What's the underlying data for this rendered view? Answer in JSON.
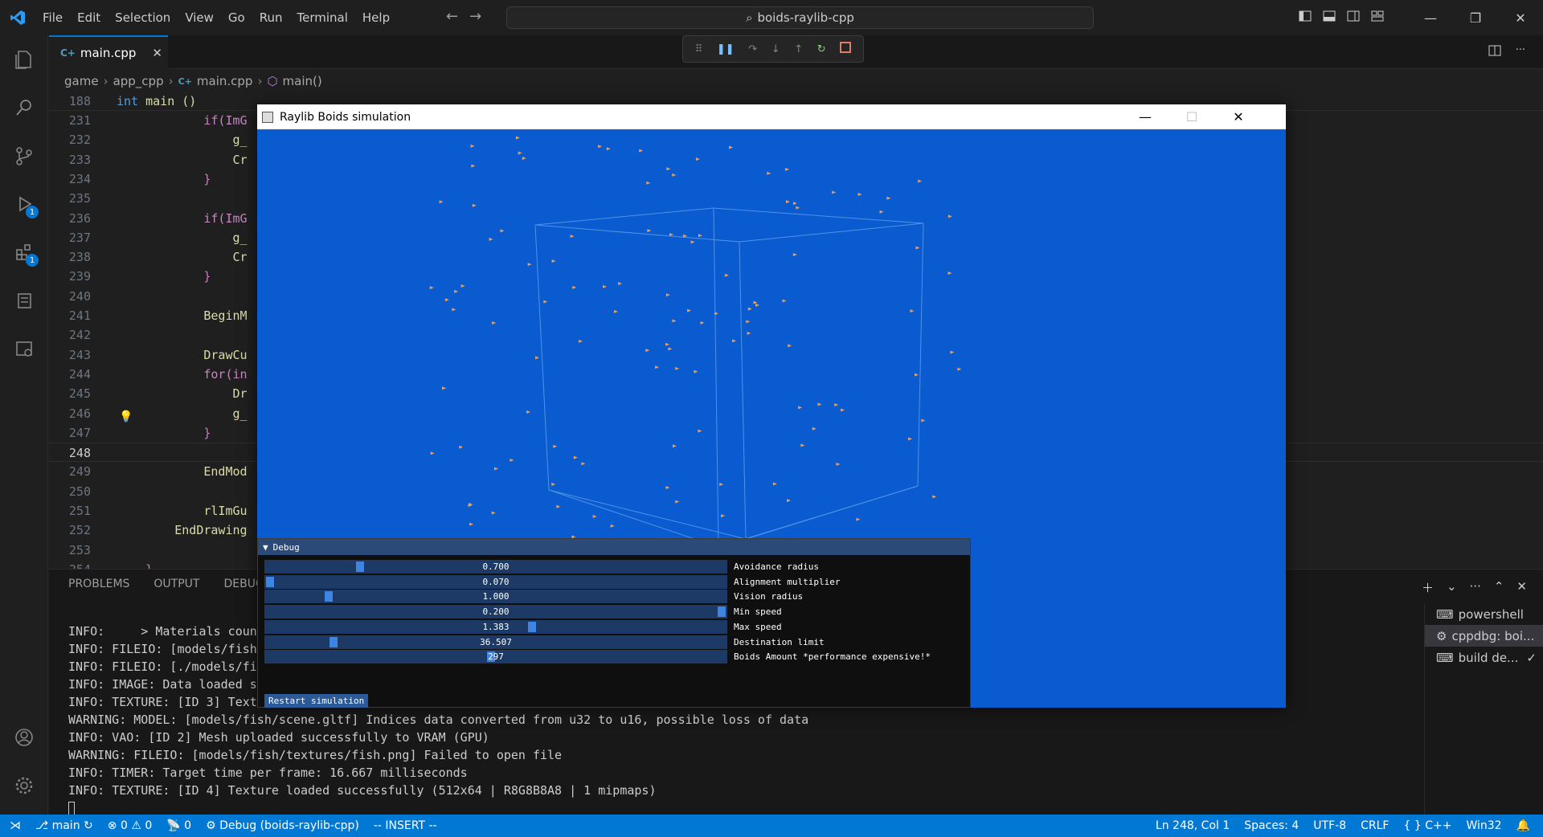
{
  "titlebar": {
    "menu": [
      "File",
      "Edit",
      "Selection",
      "View",
      "Go",
      "Run",
      "Terminal",
      "Help"
    ],
    "search": "boids-raylib-cpp"
  },
  "activity": {
    "debug_badge": "1",
    "extensions_badge": "1"
  },
  "tab": {
    "label": "main.cpp"
  },
  "breadcrumb": [
    "game",
    "app_cpp",
    "main.cpp",
    "main()"
  ],
  "editor": {
    "sticky_line": {
      "num": "188",
      "kw": "int",
      "rest": " main ()"
    },
    "lines": [
      {
        "num": "231",
        "text": "            if(ImG"
      },
      {
        "num": "232",
        "text": "                g_"
      },
      {
        "num": "233",
        "text": "                Cr"
      },
      {
        "num": "234",
        "text": "            }"
      },
      {
        "num": "235",
        "text": ""
      },
      {
        "num": "236",
        "text": "            if(ImG"
      },
      {
        "num": "237",
        "text": "                g_"
      },
      {
        "num": "238",
        "text": "                Cr"
      },
      {
        "num": "239",
        "text": "            }"
      },
      {
        "num": "240",
        "text": ""
      },
      {
        "num": "241",
        "text": "            BeginM"
      },
      {
        "num": "242",
        "text": ""
      },
      {
        "num": "243",
        "text": "            DrawCu"
      },
      {
        "num": "244",
        "text": "            for(in"
      },
      {
        "num": "245",
        "text": "                Dr"
      },
      {
        "num": "246",
        "text": "                g_"
      },
      {
        "num": "247",
        "text": "            }"
      },
      {
        "num": "248",
        "text": ""
      },
      {
        "num": "249",
        "text": "            EndMod"
      },
      {
        "num": "250",
        "text": ""
      },
      {
        "num": "251",
        "text": "            rlImGu"
      },
      {
        "num": "252",
        "text": "        EndDrawing"
      },
      {
        "num": "253",
        "text": ""
      },
      {
        "num": "254",
        "text": "    }"
      }
    ]
  },
  "panel": {
    "tabs": [
      "PROBLEMS",
      "OUTPUT",
      "DEBUG C"
    ],
    "terminal_lines": [
      "INFO:     > Materials coun",
      "INFO: FILEIO: [models/fish",
      "INFO: FILEIO: [./models/fi",
      "INFO: IMAGE: Data loaded s",
      "INFO: TEXTURE: [ID 3] Text",
      "WARNING: MODEL: [models/fish/scene.gltf] Indices data converted from u32 to u16, possible loss of data",
      "INFO: VAO: [ID 2] Mesh uploaded successfully to VRAM (GPU)",
      "WARNING: FILEIO: [models/fish/textures/fish.png] Failed to open file",
      "INFO: TIMER: Target time per frame: 16.667 milliseconds",
      "INFO: TEXTURE: [ID 4] Texture loaded successfully (512x64 | R8G8B8A8 | 1 mipmaps)"
    ],
    "terminals": [
      {
        "label": "powershell",
        "icon": "terminal-icon"
      },
      {
        "label": "cppdbg: boi...",
        "icon": "debug-icon"
      },
      {
        "label": "build de...",
        "icon": "terminal-icon"
      }
    ]
  },
  "raylib": {
    "title": "Raylib Boids simulation",
    "debug_title": "Debug",
    "sliders": [
      {
        "value": "0.700",
        "label": "Avoidance radius",
        "fill": 0.2
      },
      {
        "value": "0.070",
        "label": "Alignment multiplier",
        "fill": 0.0
      },
      {
        "value": "1.000",
        "label": "Vision radius",
        "fill": 0.13
      },
      {
        "value": "0.200",
        "label": "Min speed",
        "fill": 1.0
      },
      {
        "value": "1.383",
        "label": "Max speed",
        "fill": 0.58
      },
      {
        "value": "36.507",
        "label": "Destination limit",
        "fill": 0.14
      },
      {
        "value": "297",
        "label": "Boids Amount *performance expensive!*",
        "fill": 0.49
      }
    ],
    "restart": "Restart simulation"
  },
  "statusbar": {
    "branch": "main",
    "errors": "0",
    "warnings": "0",
    "ports": "0",
    "debug": "Debug (boids-raylib-cpp)",
    "mode": "-- INSERT --",
    "position": "Ln 248, Col 1",
    "spaces": "Spaces: 4",
    "encoding": "UTF-8",
    "eol": "CRLF",
    "language": "C++",
    "platform": "Win32"
  }
}
